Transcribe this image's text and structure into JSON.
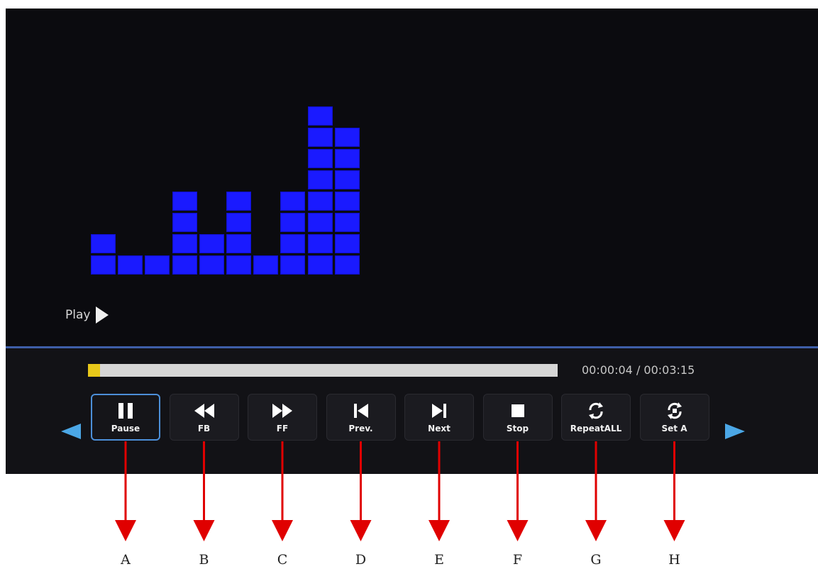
{
  "colors": {
    "equalizer": "#1a1aff",
    "progress_fill": "#e8c81a",
    "active_border": "#4c8fd8",
    "nav_arrow": "#4ba7e6",
    "callout_arrow": "#e00000"
  },
  "equalizer": {
    "levels": [
      2,
      1,
      1,
      4,
      2,
      4,
      1,
      4,
      8,
      7
    ]
  },
  "status": {
    "label": "Play",
    "icon": "play-icon"
  },
  "playback": {
    "progress": 0.025,
    "time": "00:00:04 / 00:03:15"
  },
  "navigation": {
    "left_icon": "left-arrow-icon",
    "right_icon": "right-arrow-icon"
  },
  "controls": [
    {
      "label": "Pause",
      "icon": "pause-icon",
      "active": true,
      "callout": "A"
    },
    {
      "label": "FB",
      "icon": "fast-backward-icon",
      "active": false,
      "callout": "B"
    },
    {
      "label": "FF",
      "icon": "fast-forward-icon",
      "active": false,
      "callout": "C"
    },
    {
      "label": "Prev.",
      "icon": "previous-icon",
      "active": false,
      "callout": "D"
    },
    {
      "label": "Next",
      "icon": "next-icon",
      "active": false,
      "callout": "E"
    },
    {
      "label": "Stop",
      "icon": "stop-icon",
      "active": false,
      "callout": "F"
    },
    {
      "label": "RepeatALL",
      "icon": "repeat-all-icon",
      "active": false,
      "callout": "G"
    },
    {
      "label": "Set A",
      "icon": "set-a-icon",
      "active": false,
      "callout": "H"
    }
  ]
}
